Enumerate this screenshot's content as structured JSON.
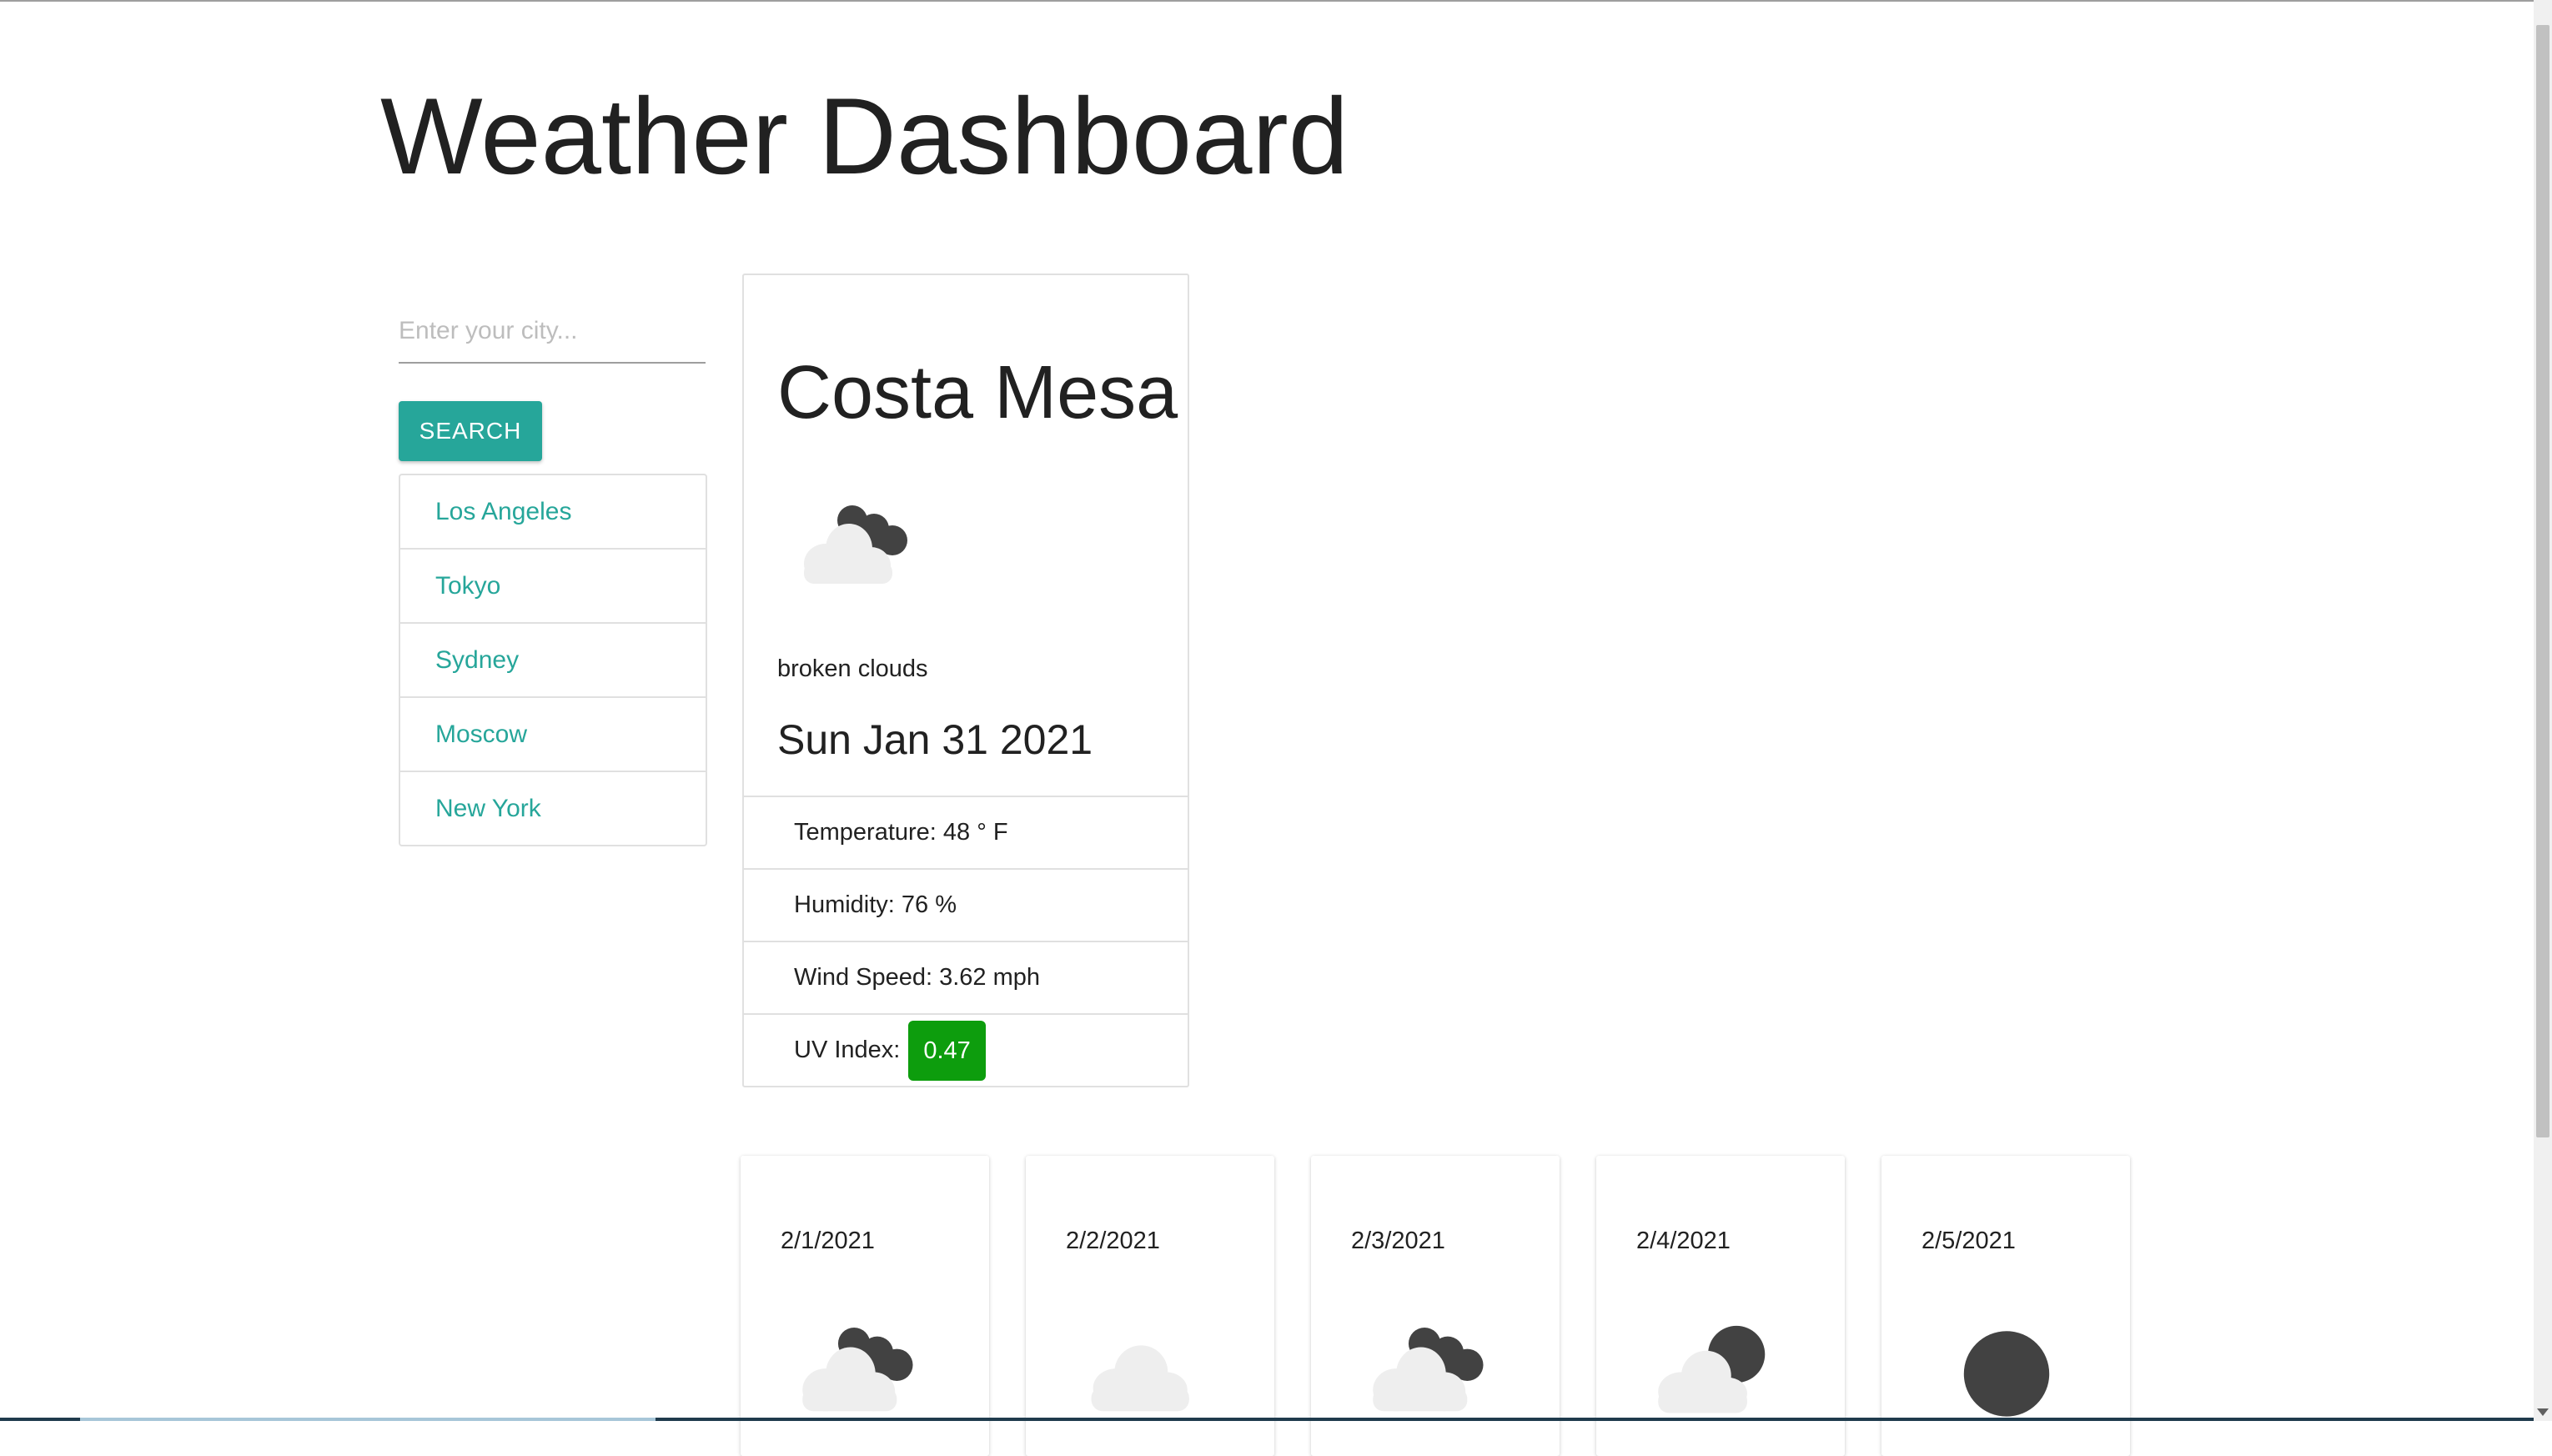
{
  "app": {
    "title": "Weather Dashboard"
  },
  "search": {
    "placeholder": "Enter your city...",
    "value": "",
    "button_label": "SEARCH"
  },
  "history": [
    "Los Angeles",
    "Tokyo",
    "Sydney",
    "Moscow",
    "New York"
  ],
  "current": {
    "city": "Costa Mesa",
    "icon": "broken-clouds-icon",
    "description": "broken clouds",
    "date": "Sun Jan 31 2021",
    "temperature": "Temperature: 48 ° F",
    "humidity": "Humidity: 76 %",
    "wind": "Wind Speed: 3.62 mph",
    "uv_label": "UV Index:",
    "uv_value": "0.47",
    "uv_color": "#0d9d0d"
  },
  "forecast": [
    {
      "date": "2/1/2021",
      "icon": "broken-clouds-icon"
    },
    {
      "date": "2/2/2021",
      "icon": "overcast-clouds-icon"
    },
    {
      "date": "2/3/2021",
      "icon": "broken-clouds-icon"
    },
    {
      "date": "2/4/2021",
      "icon": "few-clouds-night-icon"
    },
    {
      "date": "2/5/2021",
      "icon": "clear-night-icon"
    }
  ],
  "colors": {
    "accent": "#26a69a",
    "border": "#e0e0e0"
  }
}
